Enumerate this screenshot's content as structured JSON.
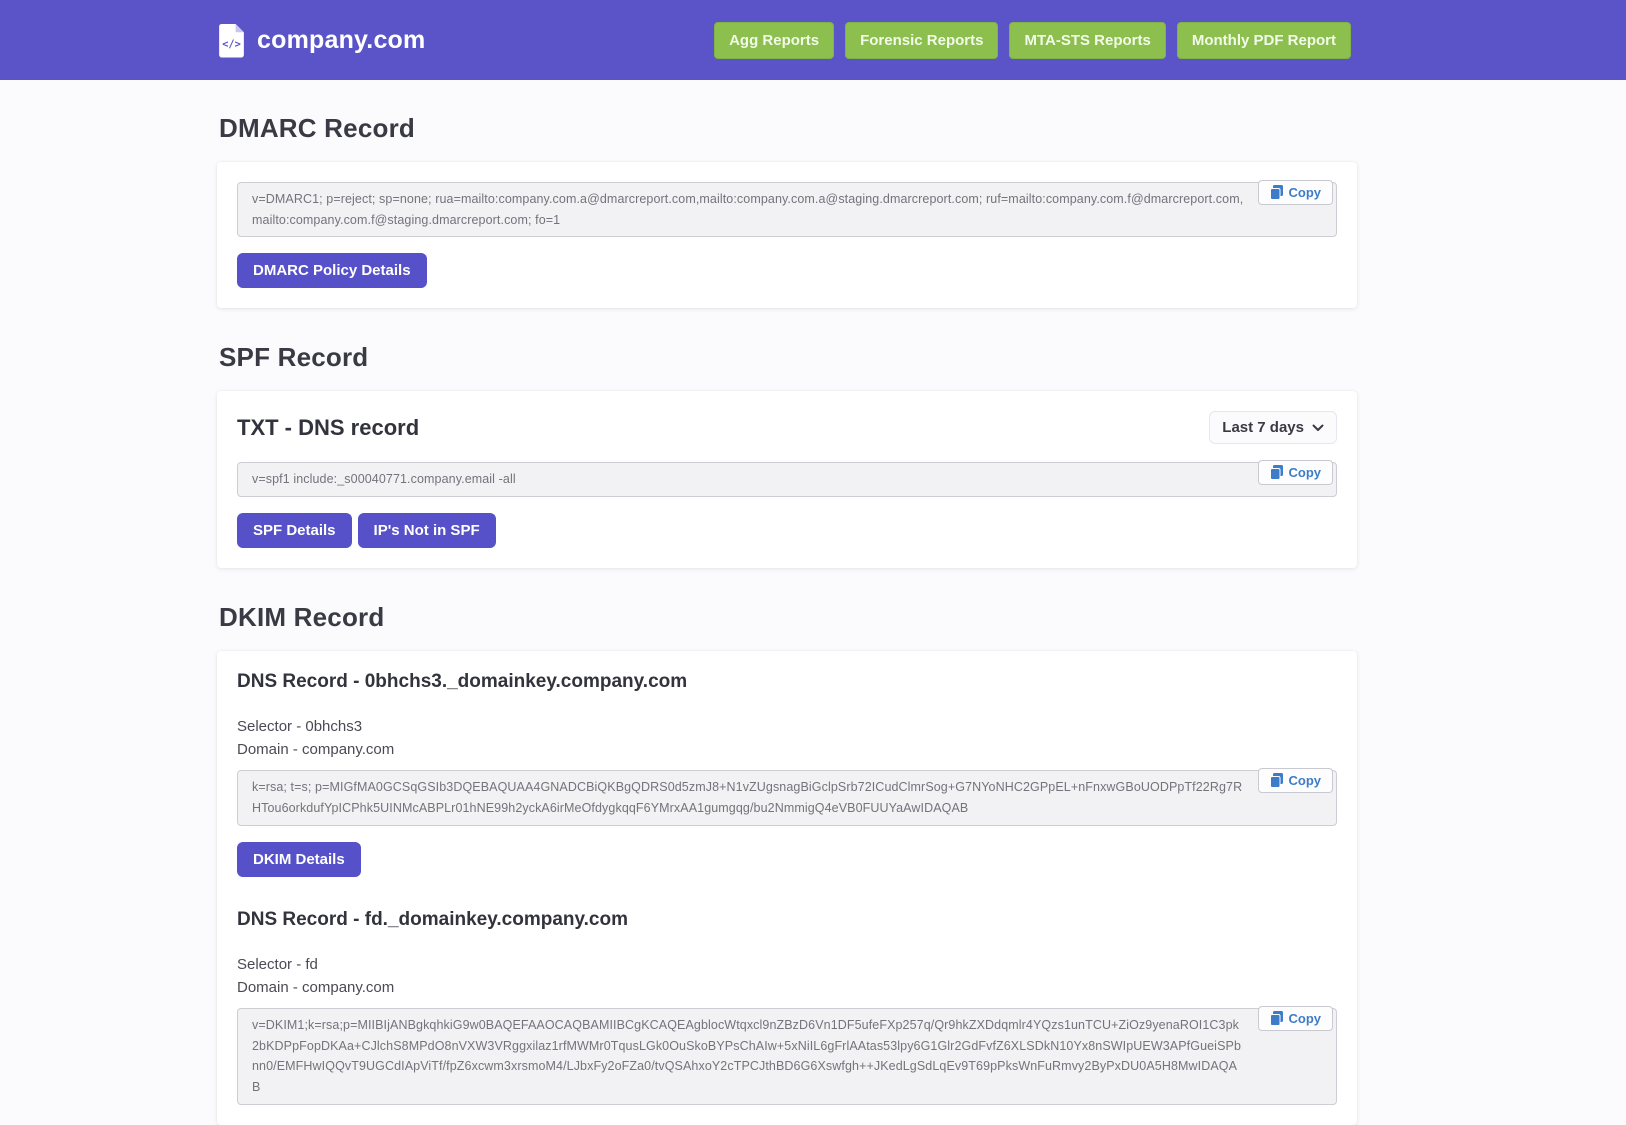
{
  "header": {
    "brand": "company.com",
    "nav": [
      {
        "label": "Agg Reports"
      },
      {
        "label": "Forensic Reports"
      },
      {
        "label": "MTA-STS Reports"
      },
      {
        "label": "Monthly PDF Report"
      }
    ]
  },
  "icons": {
    "brand": "file-code-icon",
    "copy": "copy-icon",
    "period": "chevron-down-icon"
  },
  "colors": {
    "header_bg": "#5a54c8",
    "nav_button": "#8cbf4d",
    "primary_button": "#5650c9",
    "copy_accent": "#3d7cc9"
  },
  "dmarc": {
    "title": "DMARC Record",
    "record": "v=DMARC1; p=reject; sp=none; rua=mailto:company.com.a@dmarcreport.com,mailto:company.com.a@staging.dmarcreport.com; ruf=mailto:company.com.f@dmarcreport.com,mailto:company.com.f@staging.dmarcreport.com; fo=1",
    "copy_label": "Copy",
    "details_button": "DMARC Policy Details"
  },
  "spf": {
    "title": "SPF Record",
    "card_title": "TXT - DNS record",
    "period_selector": "Last 7 days",
    "record": "v=spf1 include:_s00040771.company.email -all",
    "copy_label": "Copy",
    "buttons": [
      {
        "label": "SPF Details"
      },
      {
        "label": "IP's Not in SPF"
      }
    ]
  },
  "dkim": {
    "title": "DKIM Record",
    "records": [
      {
        "card_title": "DNS Record - 0bhchs3._domainkey.company.com",
        "selector": "Selector - 0bhchs3",
        "domain": "Domain - company.com",
        "record": "k=rsa; t=s; p=MIGfMA0GCSqGSIb3DQEBAQUAA4GNADCBiQKBgQDRS0d5zmJ8+N1vZUgsnagBiGclpSrb72ICudClmrSog+G7NYoNHC2GPpEL+nFnxwGBoUODPpTf22Rg7RHTou6orkdufYpICPhk5UINMcABPLr01hNE99h2yckA6irMeOfdygkqqF6YMrxAA1gumgqg/bu2NmmigQ4eVB0FUUYaAwIDAQAB",
        "copy_label": "Copy",
        "details_button": "DKIM Details"
      },
      {
        "card_title": "DNS Record - fd._domainkey.company.com",
        "selector": "Selector - fd",
        "domain": "Domain - company.com",
        "record": "v=DKIM1;k=rsa;p=MIIBIjANBgkqhkiG9w0BAQEFAAOCAQBAMIIBCgKCAQEAgblocWtqxcl9nZBzD6Vn1DF5ufeFXp257q/Qr9hkZXDdqmlr4YQzs1unTCU+ZiOz9yenaROI1C3pk2bKDPpFopDKAa+CJlchS8MPdO8nVXW3VRggxilaz1rfMWMr0TqusLGk0OuSkoBYPsChAIw+5xNiIL6gFrlAAtas53lpy6G1Glr2GdFvfZ6XLSDkN10Yx8nSWIpUEW3APfGueiSPbnn0/EMFHwIQQvT9UGCdIApViTf/fpZ6xcwm3xrsmoM4/LJbxFy2oFZa0/tvQSAhxoY2cTPCJthBD6G6Xswfgh++JKedLgSdLqEv9T69pPksWnFuRmvy2ByPxDU0A5H8MwIDAQAB",
        "copy_label": "Copy"
      }
    ]
  }
}
